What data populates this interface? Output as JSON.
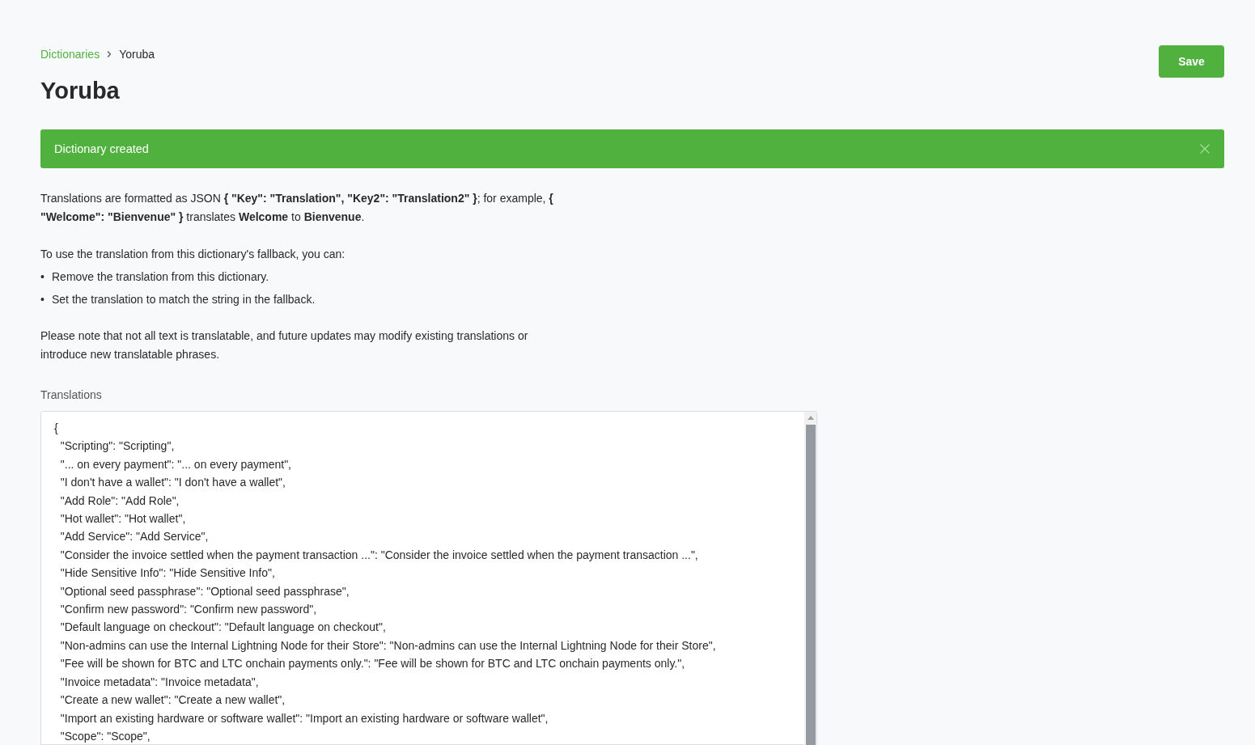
{
  "breadcrumb": [
    {
      "label": "Dictionaries",
      "link": true
    },
    {
      "label": "Yoruba",
      "link": false
    }
  ],
  "title": "Yoruba",
  "save_button": "Save",
  "alert": {
    "message": "Dictionary created"
  },
  "intro": "Translations are formatted as JSON **{ \"Key\": \"Translation\", \"Key2\": \"Translation2\" }**; for example, **{ \"Welcome\": \"Bienvenue\" }** translates **Welcome** to **Bienvenue**.",
  "fallback_text": "To use the translation from this dictionary's fallback, you can:",
  "fallback_options": [
    {
      "bullet": "•",
      "text": "Remove the translation from this dictionary."
    },
    {
      "bullet": "•",
      "text": "Set the translation to match the string in the fallback."
    }
  ],
  "note": "Please note that not all text is translatable, and future updates may modify existing translations or introduce new translatable phrases.",
  "translations": {
    "label": "Translations",
    "lines": [
      "{",
      "  \"Scripting\": \"Scripting\",",
      "  \"... on every payment\": \"... on every payment\",",
      "  \"I don't have a wallet\": \"I don't have a wallet\",",
      "  \"Add Role\": \"Add Role\",",
      "  \"Hot wallet\": \"Hot wallet\",",
      "  \"Add Service\": \"Add Service\",",
      "  \"Consider the invoice settled when the payment transaction ...\": \"Consider the invoice settled when the payment transaction ...\",",
      "  \"Hide Sensitive Info\": \"Hide Sensitive Info\",",
      "  \"Optional seed passphrase\": \"Optional seed passphrase\",",
      "  \"Confirm new password\": \"Confirm new password\",",
      "  \"Default language on checkout\": \"Default language on checkout\",",
      "  \"Non-admins can use the Internal Lightning Node for their Store\": \"Non-admins can use the Internal Lightning Node for their Store\",",
      "  \"Fee will be shown for BTC and LTC onchain payments only.\": \"Fee will be shown for BTC and LTC onchain payments only.\",",
      "  \"Invoice metadata\": \"Invoice metadata\",",
      "  \"Create a new wallet\": \"Create a new wallet\",",
      "  \"Import an existing hardware or software wallet\": \"Import an existing hardware or software wallet\",",
      "  \"Scope\": \"Scope\","
    ]
  }
}
